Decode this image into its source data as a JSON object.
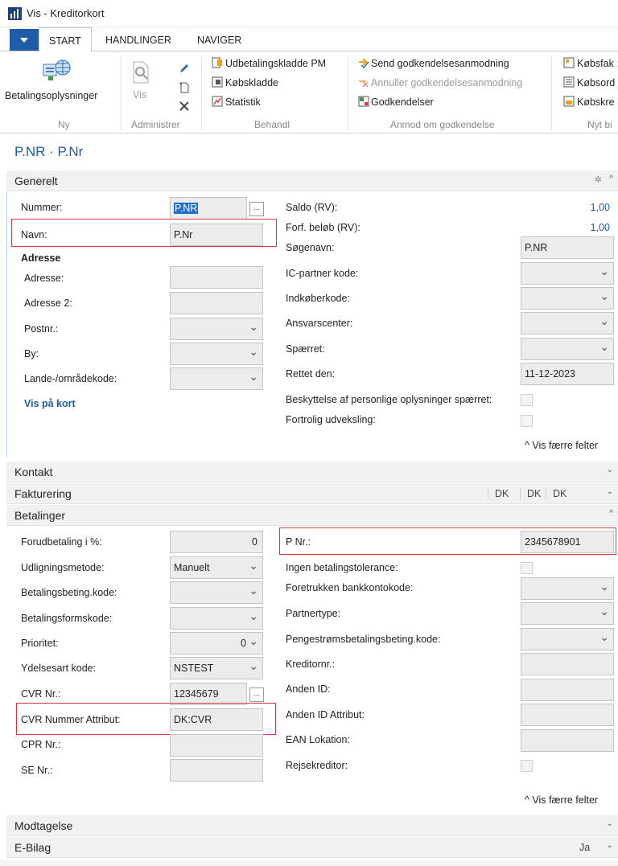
{
  "window": {
    "title": "Vis - Kreditorkort"
  },
  "ribbon_tabs": [
    "START",
    "HANDLINGER",
    "NAVIGER"
  ],
  "ribbon": {
    "ny": {
      "label": "Ny",
      "items": [
        "Betalingsoplysninger"
      ]
    },
    "administrer": {
      "label": "Administrer",
      "items": [
        "Vis"
      ]
    },
    "behandl": {
      "label": "Behandl",
      "items": [
        "Udbetalingskladde PM",
        "Købskladde",
        "Statistik"
      ]
    },
    "anmod": {
      "label": "Anmod om godkendelse",
      "items": [
        "Send godkendelsesanmodning",
        "Annuller godkendelsesanmodning",
        "Godkendelser"
      ]
    },
    "nyt_bilag": {
      "label": "Nyt bi",
      "items": [
        "Købsfak",
        "Købsord",
        "Købskre"
      ]
    }
  },
  "page_title": "P.NR · P.Nr",
  "generelt": {
    "header": "Generelt",
    "nummer_label": "Nummer:",
    "nummer_value": "P.NR",
    "navn_label": "Navn:",
    "navn_value": "P.Nr",
    "adresse_header": "Adresse",
    "adresse_label": "Adresse:",
    "adresse2_label": "Adresse 2:",
    "postnr_label": "Postnr.:",
    "by_label": "By:",
    "lande_label": "Lande-/områdekode:",
    "vis_paa_kort": "Vis på kort",
    "saldo_label": "Saldo (RV):",
    "saldo_value": "1,00",
    "forf_label": "Forf. beløb (RV):",
    "forf_value": "1,00",
    "soegenavn_label": "Søgenavn:",
    "soegenavn_value": "P.NR",
    "ic_label": "IC-partner kode:",
    "indkoeber_label": "Indkøberkode:",
    "ansvar_label": "Ansvarscenter:",
    "spaerret_label": "Spærret:",
    "rettet_label": "Rettet den:",
    "rettet_value": "11-12-2023",
    "beskyt_label": "Beskyttelse af personlige oplysninger spærret:",
    "fortrolig_label": "Fortrolig udveksling:",
    "fewer": "^ Vis færre felter"
  },
  "kontakt": {
    "header": "Kontakt"
  },
  "fakturering": {
    "header": "Fakturering",
    "summary": [
      "DK",
      "DK",
      "DK"
    ]
  },
  "betalinger": {
    "header": "Betalinger",
    "forud_label": "Forudbetaling i %:",
    "forud_value": "0",
    "udlign_label": "Udligningsmetode:",
    "udlign_value": "Manuelt",
    "betbeting_label": "Betalingsbeting.kode:",
    "betform_label": "Betalingsformskode:",
    "prioritet_label": "Prioritet:",
    "prioritet_value": "0",
    "ydelse_label": "Ydelsesart kode:",
    "ydelse_value": "NSTEST",
    "cvr_label": "CVR Nr.:",
    "cvr_value": "12345679",
    "cvr_attr_label": "CVR Nummer Attribut:",
    "cvr_attr_value": "DK:CVR",
    "cpr_label": "CPR Nr.:",
    "se_label": "SE Nr.:",
    "pnr_label": "P Nr.:",
    "pnr_value": "2345678901",
    "ingen_label": "Ingen betalingstolerance:",
    "foretrukken_label": "Foretrukken bankkontokode:",
    "partner_label": "Partnertype:",
    "pengestroem_label": "Pengestrømsbetalingsbeting.kode:",
    "kreditornr_label": "Kreditornr.:",
    "anden_label": "Anden ID:",
    "anden_attr_label": "Anden ID Attribut:",
    "ean_label": "EAN Lokation:",
    "rejse_label": "Rejsekreditor:",
    "fewer": "^ Vis færre felter"
  },
  "modtagelse": {
    "header": "Modtagelse"
  },
  "ebilag": {
    "header": "E-Bilag",
    "summary": "Ja"
  },
  "colors": {
    "accent": "#1e5ca8",
    "highlight": "#d9363e",
    "selection": "#1e6fd0"
  }
}
